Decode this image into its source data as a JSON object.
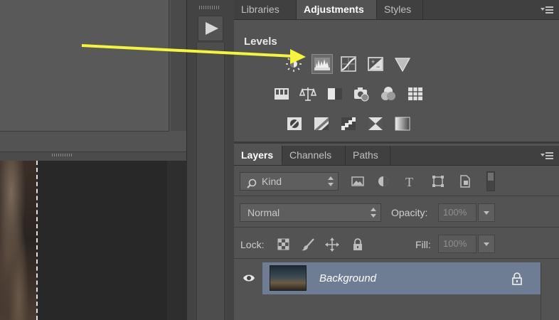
{
  "adjustments_panel": {
    "tabs": [
      {
        "label": "Libraries",
        "active": false
      },
      {
        "label": "Adjustments",
        "active": true
      },
      {
        "label": "Styles",
        "active": false
      }
    ],
    "hover_title": "Levels",
    "icon_rows": [
      [
        "brightness-contrast-icon",
        "levels-icon",
        "curves-icon",
        "exposure-icon",
        "vibrance-icon"
      ],
      [
        "hue-saturation-icon",
        "color-balance-icon",
        "black-white-icon",
        "photo-filter-icon",
        "channel-mixer-icon",
        "color-lookup-icon"
      ],
      [
        "invert-icon",
        "posterize-icon",
        "threshold-icon",
        "selective-color-icon",
        "gradient-map-icon"
      ]
    ],
    "selected_icon": "levels-icon"
  },
  "layers_panel": {
    "tabs": [
      {
        "label": "Layers",
        "active": true
      },
      {
        "label": "Channels",
        "active": false
      },
      {
        "label": "Paths",
        "active": false
      }
    ],
    "filter_kind": "Kind",
    "blend_mode": "Normal",
    "opacity_label": "Opacity:",
    "opacity_value": "100%",
    "lock_label": "Lock:",
    "fill_label": "Fill:",
    "fill_value": "100%",
    "layers": [
      {
        "name": "Background",
        "visible": true,
        "locked": true,
        "selected": true
      }
    ]
  },
  "colors": {
    "annotation_arrow": "#f5f53c",
    "selected_layer": "#6f7d94",
    "panel_bg": "#535353"
  }
}
